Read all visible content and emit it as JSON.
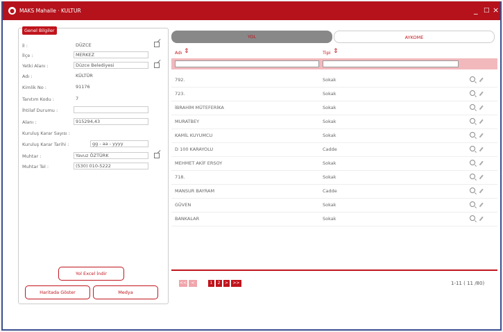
{
  "window": {
    "title": "MAKS Mahalle · KULTUR",
    "min": "_",
    "max": "□",
    "close": "×"
  },
  "form": {
    "section_label": "Genel Bilgiler",
    "fields": [
      {
        "label": "İl :",
        "value": "DÜZCE"
      },
      {
        "label": "İlçe :",
        "value": "MERKEZ"
      },
      {
        "label": "Yetki Alanı :",
        "value": "Düzce Belediyesi"
      },
      {
        "label": "Adı :",
        "value": "KÜLTÜR"
      },
      {
        "label": "Kimlik No :",
        "value": "91176"
      },
      {
        "label": "Tanıtım Kodu :",
        "value": "7"
      },
      {
        "label": "İhtilaf Durumu :",
        "value": ""
      },
      {
        "label": "Alanı :",
        "value": "915294,43"
      },
      {
        "label": "Kuruluş Karar Sayısı :",
        "value": ""
      },
      {
        "label": "Kuruluş Karar Tarihi :",
        "value": "gg - aa - yyyy"
      },
      {
        "label": "Muhtar :",
        "value": "Yavuz ÖZTÜRK"
      },
      {
        "label": "Muhtar Tel :",
        "value": "(530) 010-5222"
      }
    ],
    "excel_button": "Yol Excel İndir",
    "map_button": "Haritada Göster",
    "media_button": "Medya"
  },
  "tabs": {
    "active": "YOL",
    "inactive": "AYKOME"
  },
  "grid": {
    "col_name": "Adı",
    "col_type": "Tipi",
    "rows": [
      {
        "name": "792.",
        "type": "Sokak"
      },
      {
        "name": "723.",
        "type": "Sokak"
      },
      {
        "name": "İBRAHİM MÜTEFERİKA",
        "type": "Sokak"
      },
      {
        "name": "MURATBEY",
        "type": "Sokak"
      },
      {
        "name": "KAMİL KUYUMCU",
        "type": "Sokak"
      },
      {
        "name": "D 100 KARAYOLU",
        "type": "Cadde"
      },
      {
        "name": "MEHMET AKİF ERSOY",
        "type": "Sokak"
      },
      {
        "name": "718.",
        "type": "Sokak"
      },
      {
        "name": "MANSUR BAYRAM",
        "type": "Cadde"
      },
      {
        "name": "GÜVEN",
        "type": "Sokak"
      },
      {
        "name": "BANKALAR",
        "type": "Sokak"
      }
    ]
  },
  "pagination": {
    "first": "<<",
    "prev": "<",
    "p1": "1",
    "p2": "2",
    "next": ">",
    "last": ">>",
    "summary": "1-11 ( 11 /80)"
  },
  "colors": {
    "accent": "#c0141c",
    "titlebar": "#b5121b"
  }
}
